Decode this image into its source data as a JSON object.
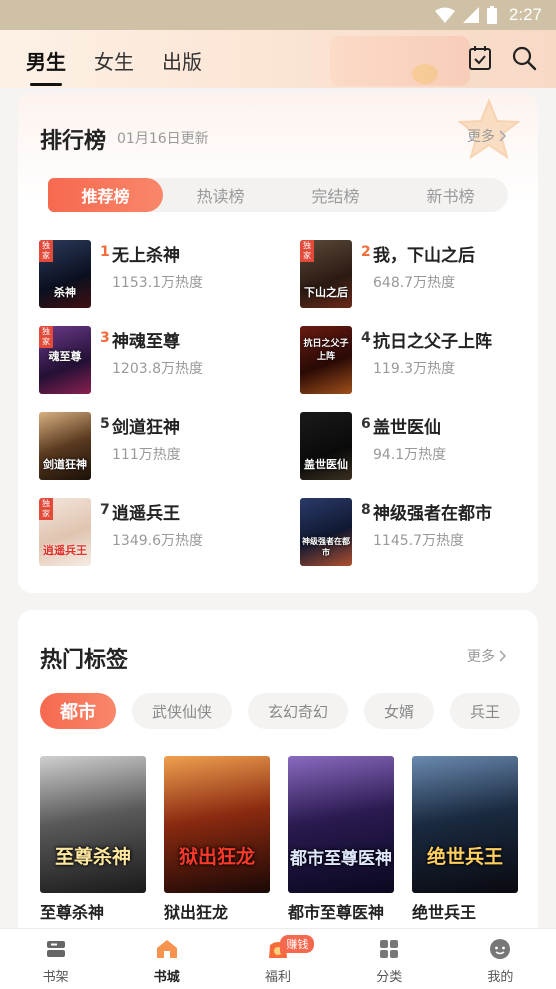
{
  "status_bar": {
    "time": "2:27"
  },
  "top_tabs": [
    {
      "label": "男生",
      "active": true
    },
    {
      "label": "女生",
      "active": false
    },
    {
      "label": "出版",
      "active": false
    }
  ],
  "ranking": {
    "title": "排行榜",
    "update_text": "01月16日更新",
    "more_label": "更多",
    "tabs": [
      {
        "label": "推荐榜",
        "active": true
      },
      {
        "label": "热读榜",
        "active": false
      },
      {
        "label": "完结榜",
        "active": false
      },
      {
        "label": "新书榜",
        "active": false
      }
    ],
    "items": [
      {
        "rank": "1",
        "title": "无上杀神",
        "heat": "1153.1万热度",
        "cover_text": "杀神"
      },
      {
        "rank": "2",
        "title": "我，下山之后",
        "heat": "648.7万热度",
        "cover_text": "下山之后"
      },
      {
        "rank": "3",
        "title": "神魂至尊",
        "heat": "1203.8万热度",
        "cover_text": "魂至尊"
      },
      {
        "rank": "4",
        "title": "抗日之父子上阵",
        "heat": "119.3万热度",
        "cover_text": "抗日之父子上阵"
      },
      {
        "rank": "5",
        "title": "剑道狂神",
        "heat": "111万热度",
        "cover_text": "剑道狂神"
      },
      {
        "rank": "6",
        "title": "盖世医仙",
        "heat": "94.1万热度",
        "cover_text": "盖世医仙"
      },
      {
        "rank": "7",
        "title": "逍遥兵王",
        "heat": "1349.6万热度",
        "cover_text": "逍遥兵王"
      },
      {
        "rank": "8",
        "title": "神级强者在都市",
        "heat": "1145.7万热度",
        "cover_text": "神级强者在都市"
      }
    ],
    "cover_badge": "独家"
  },
  "hot_tags": {
    "title": "热门标签",
    "more_label": "更多",
    "tags": [
      {
        "label": "都市",
        "active": true
      },
      {
        "label": "武侠仙侠",
        "active": false
      },
      {
        "label": "玄幻奇幻",
        "active": false
      },
      {
        "label": "女婿",
        "active": false
      },
      {
        "label": "兵王",
        "active": false
      }
    ],
    "books": [
      {
        "title": "至尊杀神",
        "cover_text": "至尊杀神"
      },
      {
        "title": "狱出狂龙",
        "cover_text": "狱出狂龙"
      },
      {
        "title": "都市至尊医神",
        "cover_text": "都市至尊医神"
      },
      {
        "title": "绝世兵王",
        "cover_text": "绝世兵王"
      }
    ]
  },
  "bottom_nav": {
    "items": [
      {
        "label": "书架",
        "icon": "bookshelf-icon",
        "active": false
      },
      {
        "label": "书城",
        "icon": "bookstore-home-icon",
        "active": true
      },
      {
        "label": "福利",
        "icon": "gift-bag-icon",
        "active": false,
        "badge": "赚钱"
      },
      {
        "label": "分类",
        "icon": "category-grid-icon",
        "active": false
      },
      {
        "label": "我的",
        "icon": "profile-icon",
        "active": false
      }
    ]
  },
  "colors": {
    "accent": "#f6694f",
    "rank_top3": "#f26b3a",
    "rank_other": "#333333"
  }
}
